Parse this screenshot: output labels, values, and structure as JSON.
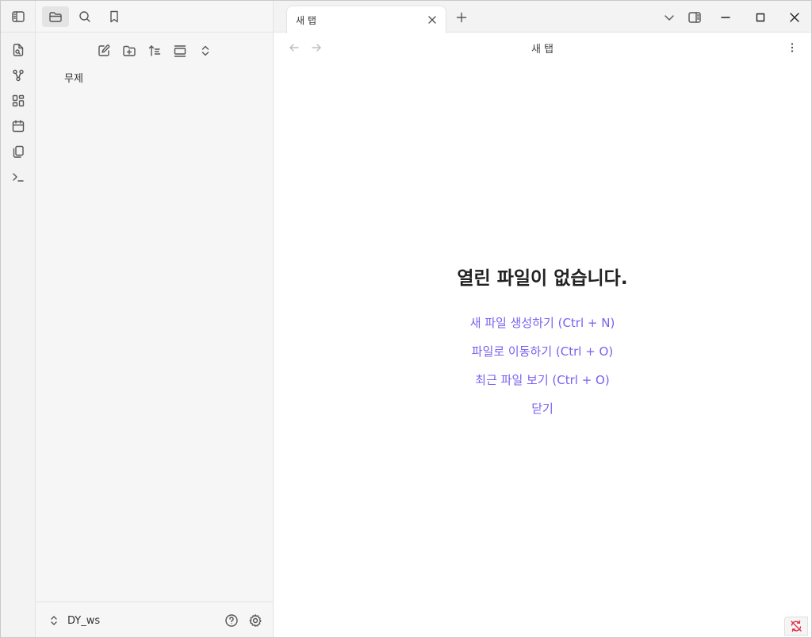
{
  "ribbon": {
    "icons": [
      "sidebar-toggle-icon",
      "open-quick-switcher-icon",
      "graph-view-icon",
      "canvas-icon",
      "daily-note-icon",
      "templates-icon",
      "command-palette-icon"
    ]
  },
  "sidebar": {
    "tabs": [
      "file-explorer-icon",
      "search-icon",
      "bookmark-icon"
    ],
    "nav_actions": [
      "new-note-icon",
      "new-folder-icon",
      "sort-icon",
      "collapse-icon",
      "expand-collapse-all-icon"
    ],
    "files": [
      {
        "name": "무제"
      }
    ],
    "vault": {
      "name": "DY_ws"
    }
  },
  "tabs": [
    {
      "title": "새 탭",
      "active": true
    }
  ],
  "view": {
    "title": "새 탭",
    "empty_title": "열린 파일이 없습니다.",
    "actions": [
      "새 파일 생성하기 (Ctrl + N)",
      "파일로 이동하기 (Ctrl + O)",
      "최근 파일 보기 (Ctrl + O)",
      "닫기"
    ]
  },
  "colors": {
    "accent": "#7b5ff0",
    "sync_error": "#e0334a"
  }
}
